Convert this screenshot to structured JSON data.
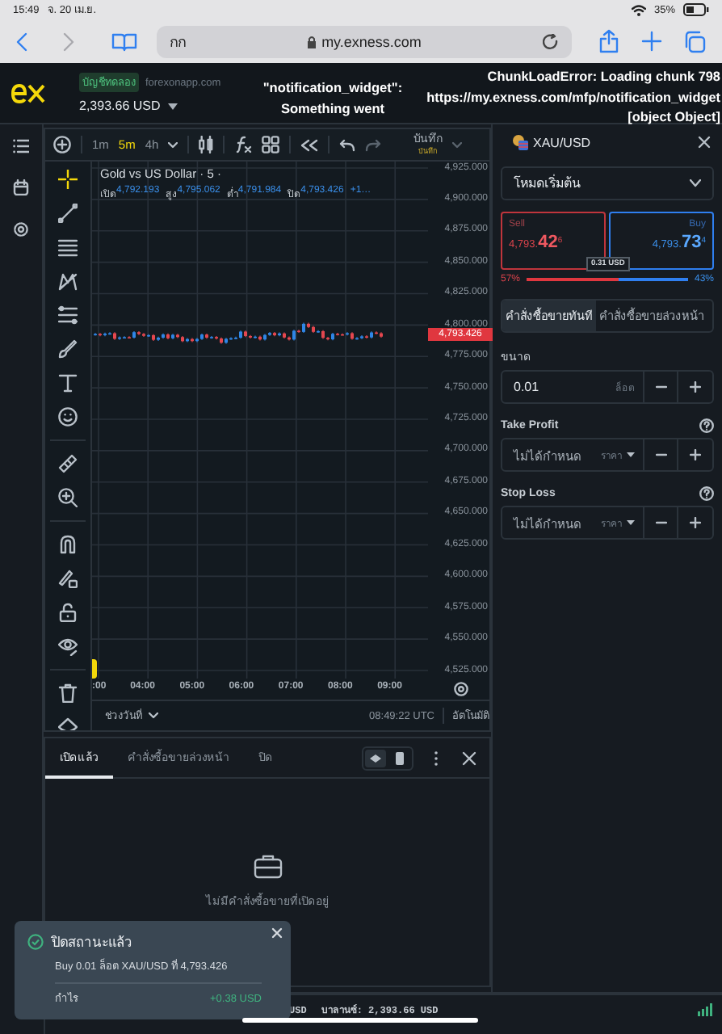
{
  "device_status": {
    "time": "15:49",
    "date": "จ. 20 เม.ย.",
    "battery": "35%"
  },
  "browser": {
    "text_size": "กก",
    "address": "my.exness.com"
  },
  "header": {
    "account_tag": "บัญชีทดลอง",
    "account_server": "forexonapp.com",
    "balance": "2,393.66 USD",
    "error_center": [
      "\"notification_widget\":",
      "Something went"
    ],
    "error_right": [
      "ChunkLoadError: Loading chunk 798",
      "https://my.exness.com/mfp/notification_widget",
      "[object Object]"
    ]
  },
  "chart_toolbar": {
    "timeframes": [
      {
        "label": "1m",
        "selected": false
      },
      {
        "label": "5m",
        "selected": true
      },
      {
        "label": "4h",
        "selected": false
      }
    ],
    "save_label": "บันทึก",
    "save_status": "บันทึก"
  },
  "chart": {
    "title": "Gold vs US Dollar · 5 ·",
    "ohlc": [
      {
        "label": "เปิด",
        "value": "4,792.193"
      },
      {
        "label": "สูง",
        "value": "4,795.062"
      },
      {
        "label": "ต่ำ",
        "value": "4,791.984"
      },
      {
        "label": "ปิด",
        "value": "4,793.426"
      }
    ],
    "change": "+1…",
    "price_labels": [
      "4,925.000",
      "4,900.000",
      "4,875.000",
      "4,850.000",
      "4,825.000",
      "4,800.000",
      "4,775.000",
      "4,750.000",
      "4,725.000",
      "4,700.000",
      "4,675.000",
      "4,650.000",
      "4,625.000",
      "4,600.000",
      "4,575.000",
      "4,550.000",
      "4,525.000"
    ],
    "current_price": "4,793.426",
    "time_labels": [
      ":00",
      "04:00",
      "05:00",
      "06:00",
      "07:00",
      "08:00",
      "09:00"
    ],
    "range_label": "ช่วงวันที่",
    "clock": "08:49:22 UTC",
    "scale_mode": "อัตโนมัติ"
  },
  "orders_panel": {
    "tabs": [
      {
        "label": "เปิดแล้ว",
        "selected": true
      },
      {
        "label": "คำสั่งซื้อขายล่วงหน้า",
        "selected": false
      },
      {
        "label": "ปิด",
        "selected": false
      }
    ],
    "view_modes": [
      {
        "selected": true
      },
      {
        "selected": false
      }
    ],
    "empty_message": "ไม่มีคำสั่งซื้อขายที่เปิดอยู่"
  },
  "trade_panel": {
    "symbol": "XAU/USD",
    "mode": "โหมดเริ่มต้น",
    "sell": {
      "label": "Sell",
      "price": "4,793.**42**$^{6}$"
    },
    "buy": {
      "label": "Buy",
      "price": "4,793.**73**$^{4}$"
    },
    "spread": "0.31 USD",
    "sentiment": {
      "sell_percent": "57%",
      "buy_percent": "43%",
      "level": 0.57
    },
    "order_types": [
      {
        "label": "คำสั่งซื้อขายทันที",
        "selected": true
      },
      {
        "label": "คำสั่งซื้อขายล่วงหน้า",
        "selected": false
      }
    ],
    "volume": {
      "label": "ขนาด",
      "value": "0.01",
      "unit": "ล็อต"
    },
    "take_profit": {
      "label": "Take Profit",
      "placeholder": "ไม่ได้กำหนด",
      "unit": "ราคา"
    },
    "stop_loss": {
      "label": "Stop Loss",
      "placeholder": "ไม่ได้กำหนด",
      "unit": "ราคา"
    }
  },
  "status_bar": {
    "partial": "USD",
    "balance": "บาลานซ์: 2,393.66 USD"
  },
  "toast": {
    "title": "ปิดสถานะแล้ว",
    "message": "Buy 0.01 ล็อต XAU/USD ที่ 4,793.426",
    "profit_label": "กำไร",
    "profit": "+0.38 USD"
  }
}
